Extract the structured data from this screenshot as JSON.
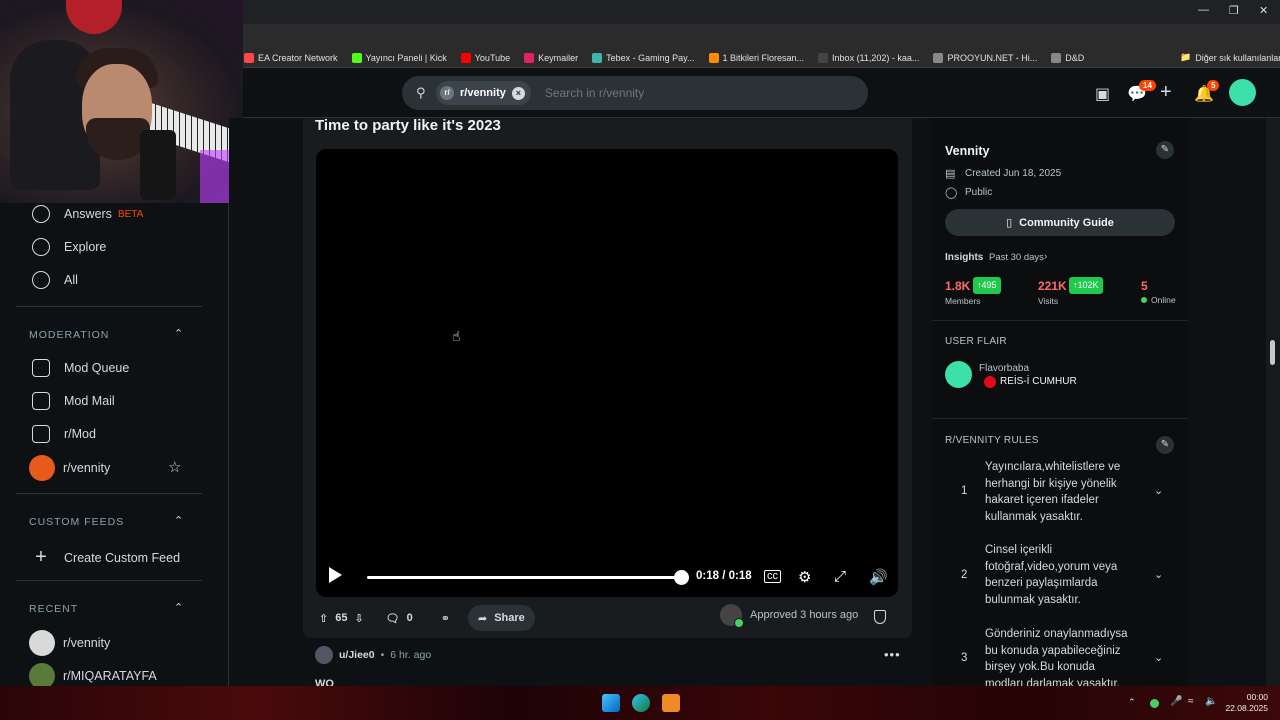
{
  "browser": {
    "bookmarks": [
      {
        "label": "EA Creator Network",
        "color": "#ff4747"
      },
      {
        "label": "Yayıncı Paneli | Kick",
        "color": "#53fc18"
      },
      {
        "label": "YouTube",
        "color": "#ff0000"
      },
      {
        "label": "Keymailer",
        "color": "#e0245e"
      },
      {
        "label": "Tebex - Gaming Pay...",
        "color": "#3fb6a8"
      },
      {
        "label": "1 Bitkileri Floresan...",
        "color": "#ff8a00"
      },
      {
        "label": "Inbox (11,202) - kaa...",
        "color": "#444444"
      },
      {
        "label": "PROOYUN.NET - Hi...",
        "color": "#888888"
      },
      {
        "label": "D&D",
        "color": "#888888"
      }
    ],
    "other_bookmarks": "Diğer sık kullanılanlar"
  },
  "header": {
    "chip_label": "r/vennity",
    "search_placeholder": "Search in r/vennity",
    "chat_badge": "14",
    "notif_badge": "5"
  },
  "leftnav": {
    "items_top": [
      {
        "label": "Answers",
        "tag": "BETA"
      },
      {
        "label": "Explore"
      },
      {
        "label": "All"
      }
    ],
    "moderation_title": "MODERATION",
    "moderation": [
      "Mod Queue",
      "Mod Mail",
      "r/Mod",
      "r/vennity"
    ],
    "custom_feeds_title": "CUSTOM FEEDS",
    "create_feed": "Create Custom Feed",
    "recent_title": "RECENT",
    "recent": [
      "r/vennity",
      "r/MIQARATAYFA"
    ]
  },
  "post": {
    "title": "Time to party like it's 2023",
    "video_time": "0:18 / 0:18",
    "votes": "65",
    "comments": "0",
    "share": "Share",
    "approved": "Approved 3 hours ago"
  },
  "comment": {
    "author": "u/Jiee0",
    "age": "6 hr. ago",
    "separator": "•",
    "text": "WO"
  },
  "community": {
    "name": "Vennity",
    "created": "Created Jun 18, 2025",
    "visibility": "Public",
    "guide": "Community Guide",
    "insights": "Insights",
    "insights_range": "Past 30 days",
    "members": "1.8K",
    "members_delta": "495",
    "members_label": "Members",
    "visits": "221K",
    "visits_delta": "102K",
    "visits_label": "Visits",
    "online": "5",
    "online_label": "Online",
    "flair_title": "USER FLAIR",
    "flair_user": "Flavorbaba",
    "flair_text": "REİS-İ CUMHUR",
    "rules_title": "R/VENNITY RULES",
    "rules": [
      {
        "num": "1",
        "text": "Yayıncılara,whitelistlere ve herhangi bir kişiye yönelik hakaret içeren ifadeler kullanmak yasaktır."
      },
      {
        "num": "2",
        "text": "Cinsel içerikli fotoğraf,video,yorum veya benzeri paylaşımlarda bulunmak yasaktır."
      },
      {
        "num": "3",
        "text": "Gönderiniz onaylanmadıysa bu konuda yapabileceğiniz birşey yok.Bu konuda modları darlamak yasaktır."
      }
    ]
  },
  "taskbar": {
    "time": "00:00",
    "date": "22.08.2025"
  }
}
